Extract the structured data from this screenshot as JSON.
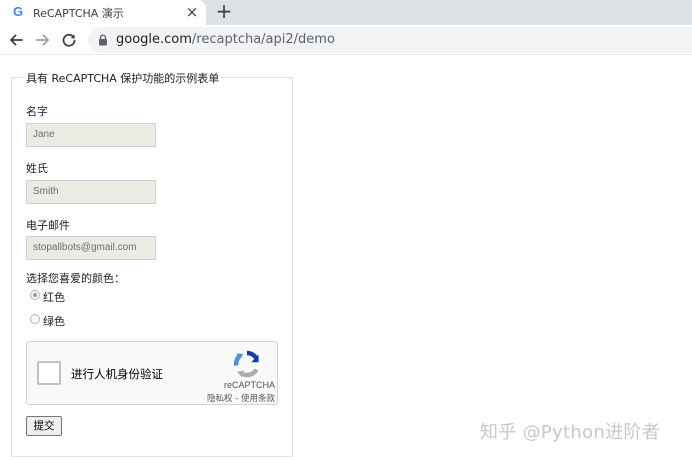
{
  "browser": {
    "tab": {
      "favicon": "G",
      "title": "ReCAPTCHA 演示",
      "close_glyph": "×"
    },
    "new_tab_glyph": "+",
    "address_bar": {
      "host": "google.com",
      "path": "/recaptcha/api2/demo"
    },
    "icons": [
      "back-arrow-icon",
      "forward-arrow-icon",
      "reload-icon",
      "lock-icon",
      "google-favicon-icon"
    ]
  },
  "form": {
    "legend": "具有 ReCAPTCHA 保护功能的示例表单",
    "fields": [
      {
        "label": "名字",
        "value": "Jane"
      },
      {
        "label": "姓氏",
        "value": "Smith"
      },
      {
        "label": "电子邮件",
        "value": "stopallbots@gmail.com"
      }
    ],
    "color_question": "选择您喜爱的颜色：",
    "color_options": [
      {
        "label": "红色",
        "checked": true
      },
      {
        "label": "绿色",
        "checked": false
      }
    ],
    "recaptcha": {
      "checkbox_label": "进行人机身份验证",
      "brand": "reCAPTCHA",
      "terms": "隐私权 - 使用条款",
      "logo_icon": "recaptcha-logo-icon",
      "colors": {
        "blue": "#1c3aa9",
        "light_blue": "#4a90e2",
        "grey": "#ababab"
      }
    },
    "submit_label": "提交"
  },
  "watermark": "知乎 @Python进阶者",
  "colors": {
    "tabstrip": "#dee1e6",
    "omnibox": "#f1f3f4",
    "disabled_input": "#ebebe4"
  }
}
